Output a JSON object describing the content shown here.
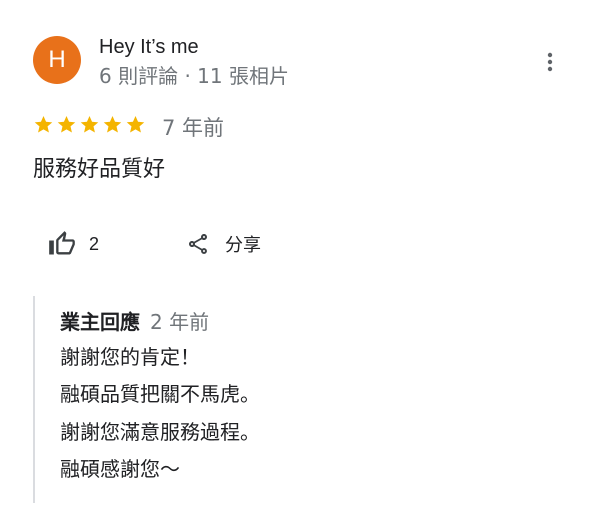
{
  "review": {
    "author_initial": "H",
    "author_name": "Hey It’s me",
    "author_meta": "6 則評論 · 11 張相片",
    "rating": 5,
    "rating_max": 5,
    "time": "7 年前",
    "text": "服務好品質好",
    "likes": "2",
    "share_label": "分享",
    "more_icon": "more-vert-icon",
    "star_icon": "star-icon",
    "like_icon": "thumb-up-icon",
    "share_icon": "share-icon"
  },
  "owner_reply": {
    "label": "業主回應",
    "time": "2 年前",
    "lines": [
      "謝謝您的肯定！",
      "融碩品質把關不馬虎。",
      "謝謝您滿意服務過程。",
      "融碩感謝您～"
    ]
  },
  "colors": {
    "avatar_bg": "#e8711a",
    "star": "#f4b400",
    "secondary_text": "#70757a",
    "primary_text": "#202124",
    "reply_border": "#dadce0"
  }
}
